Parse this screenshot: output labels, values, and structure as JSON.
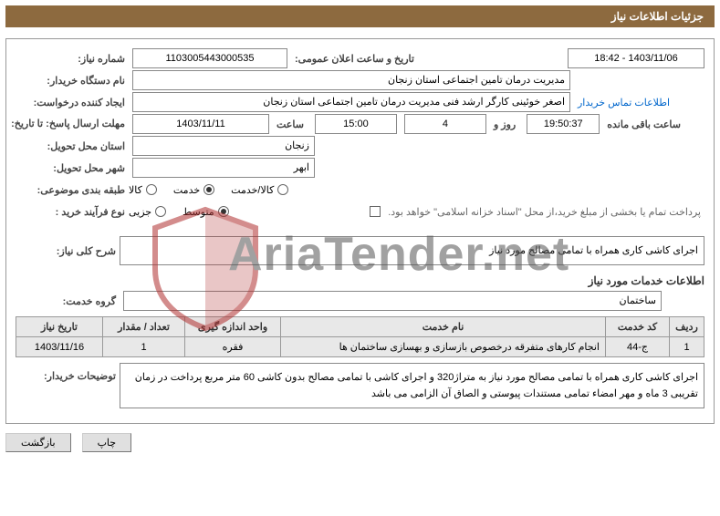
{
  "header": {
    "title": "جزئیات اطلاعات نیاز"
  },
  "fields": {
    "need_number_label": "شماره نیاز:",
    "need_number": "1103005443000535",
    "announce_label": "تاریخ و ساعت اعلان عمومی:",
    "announce_value": "1403/11/06 - 18:42",
    "buyer_org_label": "نام دستگاه خریدار:",
    "buyer_org": "مدیریت درمان تامین اجتماعی استان زنجان",
    "creator_label": "ایجاد کننده درخواست:",
    "creator": "اصغر خوئینی کارگر ارشد فنی مدیریت درمان تامین اجتماعی استان زنجان",
    "contact_link": "اطلاعات تماس خریدار",
    "deadline_label": "مهلت ارسال پاسخ: تا تاریخ:",
    "deadline_date": "1403/11/11",
    "hour_label": "ساعت",
    "deadline_hour": "15:00",
    "days_remaining": "4",
    "days_label": "روز و",
    "time_remaining": "19:50:37",
    "time_remaining_label": "ساعت باقی مانده",
    "delivery_province_label": "استان محل تحویل:",
    "delivery_province": "زنجان",
    "delivery_city_label": "شهر محل تحویل:",
    "delivery_city": "ابهر",
    "category_label": "طبقه بندی موضوعی:",
    "cat_goods": "کالا",
    "cat_service": "خدمت",
    "cat_goods_service": "کالا/خدمت",
    "process_type_label": "نوع فرآیند خرید :",
    "process_partial": "جزیی",
    "process_medium": "متوسط",
    "treasury_note": "پرداخت تمام یا بخشی از مبلغ خرید،از محل \"اسناد خزانه اسلامی\" خواهد بود."
  },
  "need_summary": {
    "label": "شرح کلی نیاز:",
    "text": "اجرای کاشی کاری همراه  با تمامی مصالح مورد نیاز"
  },
  "services_section_title": "اطلاعات خدمات مورد نیاز",
  "service_group": {
    "label": "گروه خدمت:",
    "value": "ساختمان"
  },
  "table": {
    "headers": {
      "row": "ردیف",
      "code": "کد خدمت",
      "name": "نام خدمت",
      "unit": "واحد اندازه گیری",
      "qty": "تعداد / مقدار",
      "need_date": "تاریخ نیاز"
    },
    "rows": [
      {
        "row": "1",
        "code": "ج-44",
        "name": "انجام کارهای متفرقه درخصوص بازسازی و بهسازی ساختمان ها",
        "unit": "فقره",
        "qty": "1",
        "need_date": "1403/11/16"
      }
    ]
  },
  "buyer_notes": {
    "label": "توضیحات خریدار:",
    "text": "اجرای کاشی کاری همراه  با تمامی مصالح مورد نیاز به متراژ320 و اجرای کاشی با تمامی مصالح بدون کاشی 60 متر مربع پرداخت در زمان تقریبی 3 ماه و مهر امضاء تمامی مستندات پیوستی و الصاق آن الزامی می باشد"
  },
  "buttons": {
    "print": "چاپ",
    "back": "بازگشت"
  },
  "watermark": {
    "text": "AriaTender.net"
  }
}
